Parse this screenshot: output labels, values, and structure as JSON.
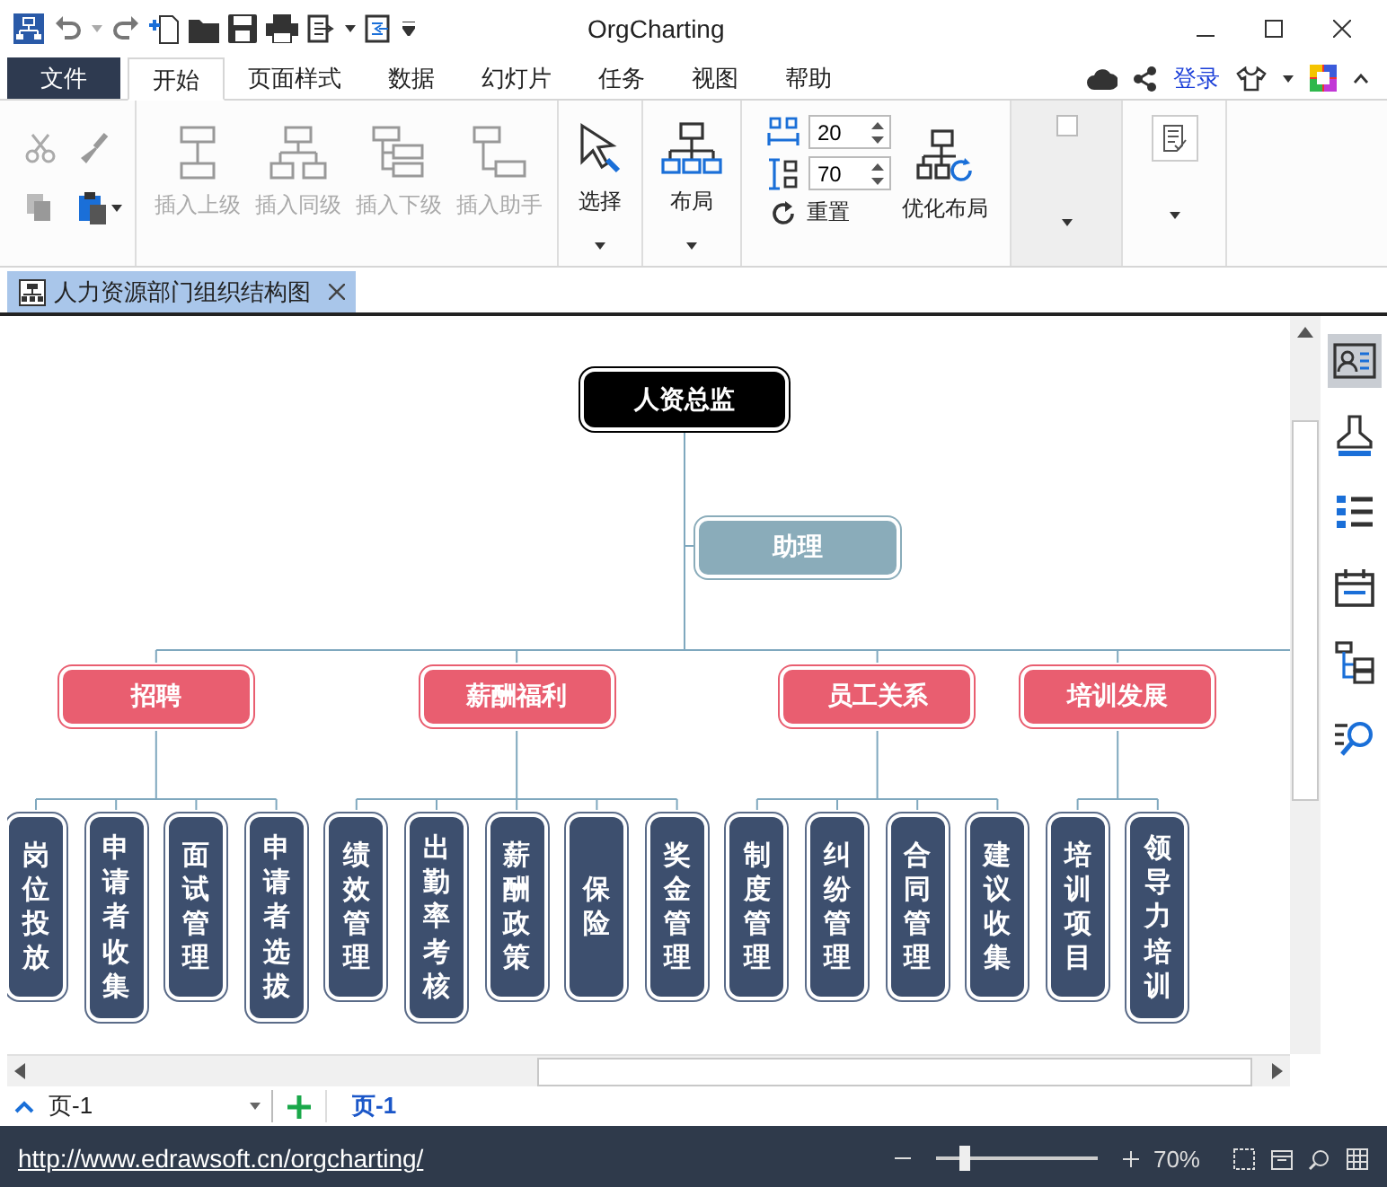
{
  "window": {
    "title": "OrgCharting"
  },
  "menu_tabs": [
    {
      "label": "文件",
      "kind": "file",
      "selected": false
    },
    {
      "label": "开始",
      "kind": "tab",
      "selected": true
    },
    {
      "label": "页面样式",
      "kind": "tab",
      "selected": false
    },
    {
      "label": "数据",
      "kind": "tab",
      "selected": false
    },
    {
      "label": "幻灯片",
      "kind": "tab",
      "selected": false
    },
    {
      "label": "任务",
      "kind": "tab",
      "selected": false
    },
    {
      "label": "视图",
      "kind": "tab",
      "selected": false
    },
    {
      "label": "帮助",
      "kind": "tab",
      "selected": false
    }
  ],
  "account": {
    "login": "登录"
  },
  "ribbon": {
    "insert_buttons": [
      {
        "label": "插入上级",
        "kind": "parent",
        "disabled": true
      },
      {
        "label": "插入同级",
        "kind": "sibling",
        "disabled": true
      },
      {
        "label": "插入下级",
        "kind": "child",
        "disabled": true
      },
      {
        "label": "插入助手",
        "kind": "assistant",
        "disabled": true
      }
    ],
    "select": "选择",
    "layout": "布局",
    "spacing": [
      {
        "kind": "horizontal",
        "value": "20"
      },
      {
        "kind": "vertical",
        "value": "70"
      }
    ],
    "reset": "重置",
    "optimize": "优化布局",
    "option_checked": false
  },
  "document_tab": {
    "title": "人力资源部门组织结构图"
  },
  "org_chart": {
    "root": "人资总监",
    "assistant": "助理",
    "departments": [
      {
        "name": "招聘",
        "children": [
          {
            "name": "岗位投放"
          },
          {
            "name": "申请者收集"
          },
          {
            "name": "面试管理"
          },
          {
            "name": "申请者选拔"
          }
        ]
      },
      {
        "name": "薪酬福利",
        "children": [
          {
            "name": "绩效管理"
          },
          {
            "name": "出勤率考核"
          },
          {
            "name": "薪酬政策"
          },
          {
            "name": "保险"
          },
          {
            "name": "奖金管理"
          }
        ]
      },
      {
        "name": "员工关系",
        "children": [
          {
            "name": "制度管理"
          },
          {
            "name": "纠纷管理"
          },
          {
            "name": "合同管理"
          },
          {
            "name": "建议收集"
          }
        ]
      },
      {
        "name": "培训发展",
        "children": [
          {
            "name": "培训项目"
          },
          {
            "name": "领导力培训"
          }
        ]
      }
    ]
  },
  "side_panel": [
    {
      "kind": "contact",
      "selected": true
    },
    {
      "kind": "brush",
      "selected": false
    },
    {
      "kind": "list",
      "selected": false
    },
    {
      "kind": "calendar",
      "selected": false
    },
    {
      "kind": "tree",
      "selected": false
    },
    {
      "kind": "search",
      "selected": false
    }
  ],
  "page_bar": {
    "page_select": "页-1",
    "pages": [
      {
        "label": "页-1",
        "selected": true
      }
    ]
  },
  "status_bar": {
    "url": "http://www.edrawsoft.cn/orgcharting/",
    "zoom": "70%",
    "level": 0.18
  }
}
